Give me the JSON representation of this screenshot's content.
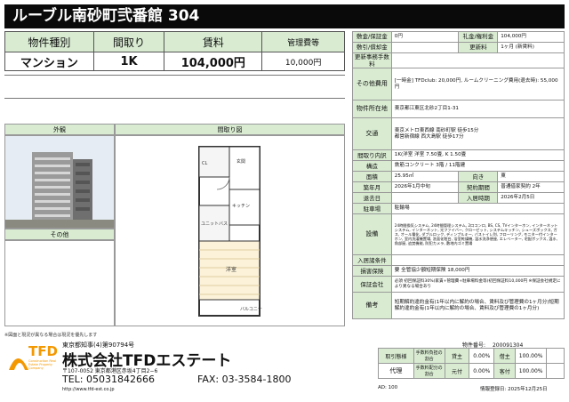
{
  "title": "ルーブル南砂町弐番館 304",
  "summary": {
    "headers": [
      "物件種別",
      "間取り",
      "賃料",
      "管理費等"
    ],
    "values": [
      "マンション",
      "1K",
      "104,000円",
      "10,000円"
    ]
  },
  "details": {
    "deposit_label": "敷金/保証金",
    "deposit_value": "0円",
    "key_money_label": "礼金/権利金",
    "key_money_value": "104,000円",
    "amortization_label": "敷引/償却金",
    "amortization_value": "",
    "renewal_label": "更新料",
    "renewal_value": "1ヶ月 (新賃料)",
    "renewal_fee_label": "更新事務手数料",
    "renewal_fee_value": "",
    "other_costs_label": "その他費用",
    "other_costs_value": "[一時金] TFDclub: 20,000円, ルームクリーニング費用(退去時): 55,000円",
    "address_label": "物件所在地",
    "address_value": "東京都江東区北砂2丁目1-31",
    "transport_label": "交通",
    "transport_lines": [
      "東京メトロ東西線 南砂町駅 徒歩15分",
      "都営新宿線 西大島駅 徒歩17分"
    ],
    "layout_detail_label": "間取り内訳",
    "layout_detail_value": "1K(洋室 洋室 7.50畳, K 1.50畳",
    "structure_label": "構造",
    "structure_value": "鉄筋コンクリート 3階 / 11階建",
    "area_label": "面積",
    "area_value": "25.95㎡",
    "direction_label": "向き",
    "direction_value": "東",
    "built_label": "築年月",
    "built_value": "2026年1月中旬",
    "contract_label": "契約期間",
    "contract_value": "普通借家契約 2年",
    "moveout_label": "退去日",
    "moveout_value": "",
    "movein_label": "入居時期",
    "movein_value": "2026年2月5日",
    "parking_label": "駐車場",
    "parking_value": "駐輪場",
    "equipment_label": "設備",
    "equipment_value": "24時間換気システム, 24時間管理システム, 2口コンロ, BS, CS, TVインターホン, インターネットシステム, インターネット, 光ファイバー, クローゼット, システムキッチン, シューズボックス, ガス, オール電化, ダブルロック, ディンプルキー, バストイレ別, フローリング, モニター付インターホン, 室内洗濯機置場, 洗面化粧台, 浴室乾燥機, 温水洗浄便座, エレベーター, 宅配ボックス, 温水, 角部屋, 追焚機能, 防犯カメラ, 敷地内ゴミ置場",
    "guarantor_label": "入居諸条件",
    "guarantor_value": "",
    "insurance_label": "損害保険",
    "insurance_value": "要 全管協少額短期保険 18,000円",
    "guarantee_label": "保証会社",
    "guarantee_value": "必須 初回保証料30%(家賃+管理費+駐車場料金等)初回保証料10,000円 ※保証会社規定により異なる場合あり",
    "remarks_label": "備考",
    "remarks_value": "短期解約違約金有(1年以内に解約の場合、賃料及び管理費の1ヶ月分)短期解約違約金有(1年以内に解約の場合、賃料及び管理費の1ヶ月分)"
  },
  "panels": {
    "exterior_label": "外観",
    "floorplan_label": "間取り図",
    "other_label": "その他",
    "fp_labels": {
      "entrance": "玄関",
      "kitchen": "キッチン",
      "bath": "ユニットバス",
      "room": "洋室",
      "balcony": "バルコニー",
      "closet": "CL"
    }
  },
  "disclaimer": "※図面と現況が異なる場合は現況を優先します",
  "company": {
    "license": "東京都知事(4)第90794号",
    "name": "株式会社TFDエステート",
    "address": "〒107-0052 東京都港区赤坂4丁目2−6",
    "tel": "TEL: 05031842666",
    "fax": "FAX: 03-3584-1800",
    "url": "http://www.tfd-est.co.jp",
    "logo_text": "TFD",
    "logo_sub": "Construction Real Estate Property Company"
  },
  "property_no_label": "物件番号:",
  "property_no": "200091304",
  "transaction": {
    "mode_label": "取引態様",
    "mode_value": "代理",
    "fee_burden_label": "手数料負担の割合",
    "fee_share_label": "手数料配分の割合",
    "rows": [
      {
        "party_a": "貸主",
        "a_value": "0.00%",
        "party_b": "借主",
        "b_value": "100.00%"
      },
      {
        "party_a": "元付",
        "a_value": "0.00%",
        "party_b": "客付",
        "b_value": "100.00%"
      }
    ]
  },
  "ad_label": "AD:",
  "ad_value": "100",
  "registered_label": "情報登録日:",
  "registered_value": "2025年12月25日",
  "colors": {
    "header_bg": "#0a0a0a",
    "label_bg": "#d9ecd2",
    "logo_orange": "#f39800"
  }
}
